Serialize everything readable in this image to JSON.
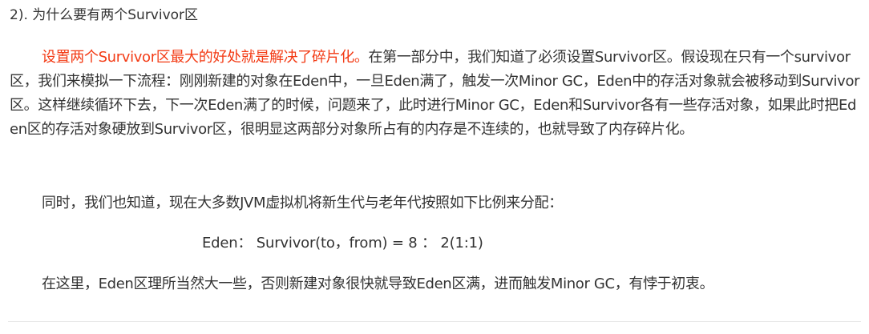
{
  "heading": "2). 为什么要有两个Survivor区",
  "paragraph1": {
    "highlight": "设置两个Survivor区最大的好处就是解决了碎片化。",
    "rest": "在第一部分中，我们知道了必须设置Survivor区。假设现在只有一个survivor区，我们来模拟一下流程：刚刚新建的对象在Eden中，一旦Eden满了，触发一次Minor GC，Eden中的存活对象就会被移动到Survivor区。这样继续循环下去，下一次Eden满了的时候，问题来了，此时进行Minor GC，Eden和Survivor各有一些存活对象，如果此时把Eden区的存活对象硬放到Survivor区，很明显这两部分对象所占有的内存是不连续的，也就导致了内存碎片化。"
  },
  "paragraph2": "同时，我们也知道，现在大多数JVM虚拟机将新生代与老年代按照如下比例来分配：",
  "formula": "Eden： Survivor(to，from) = 8 ： 2(1:1)",
  "paragraph3": "在这里，Eden区理所当然大一些，否则新建对象很快就导致Eden区满，进而触发Minor GC，有悖于初衷。",
  "colors": {
    "text": "#333333",
    "highlight": "#f33b15",
    "divider": "#e6e6e6"
  }
}
